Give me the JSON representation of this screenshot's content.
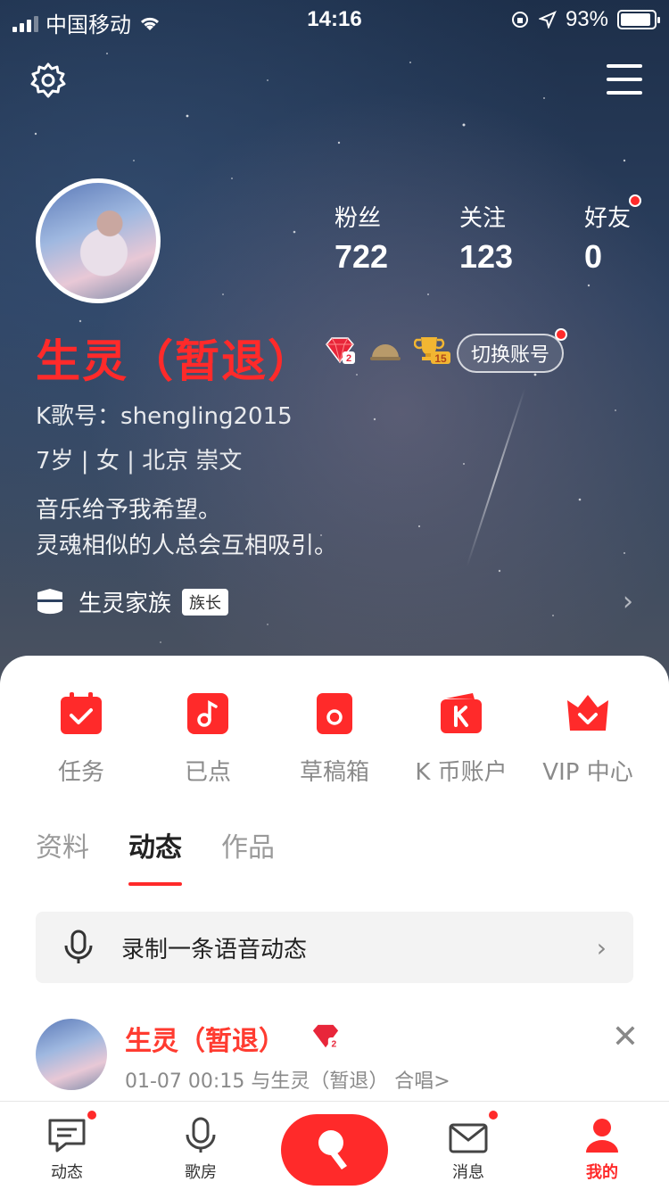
{
  "status_bar": {
    "carrier": "中国移动",
    "time": "14:16",
    "battery": "93%",
    "battery_level": 0.93
  },
  "header": {
    "settings_icon": "gear-icon",
    "menu_icon": "hamburger-menu-icon"
  },
  "profile": {
    "name": "生灵（暂退）",
    "stats": [
      {
        "label": "粉丝",
        "value": "722"
      },
      {
        "label": "关注",
        "value": "123"
      },
      {
        "label": "好友",
        "value": "0"
      }
    ],
    "switch_account": "切换账号",
    "k_id": "K歌号：shengling2015",
    "details": "7岁 | 女 | 北京 崇文",
    "bio_line1": "音乐给予我希望。",
    "bio_line2": "灵魂相似的人总会互相吸引。",
    "family_name": "生灵家族",
    "family_role": "族长",
    "badge_level_gem": "2",
    "badge_level_trophy": "15"
  },
  "quick_actions": [
    {
      "label": "任务",
      "icon": "calendar-check-icon"
    },
    {
      "label": "已点",
      "icon": "music-note-icon"
    },
    {
      "label": "草稿箱",
      "icon": "draft-box-icon"
    },
    {
      "label": "K 币账户",
      "icon": "k-coin-wallet-icon"
    },
    {
      "label": "VIP 中心",
      "icon": "crown-icon"
    }
  ],
  "tabs": [
    {
      "label": "资料"
    },
    {
      "label": "动态",
      "active": true
    },
    {
      "label": "作品"
    }
  ],
  "voice_post": {
    "label": "录制一条语音动态"
  },
  "feed_item": {
    "name": "生灵（暂退）",
    "meta": "01-07 00:15  与生灵（暂退） 合唱>"
  },
  "bottom_nav": [
    {
      "label": "动态"
    },
    {
      "label": "歌房"
    },
    {
      "label": "消息"
    },
    {
      "label": "我的"
    }
  ],
  "colors": {
    "accent": "#ff2a2a",
    "header_bg": "#2d4160"
  }
}
